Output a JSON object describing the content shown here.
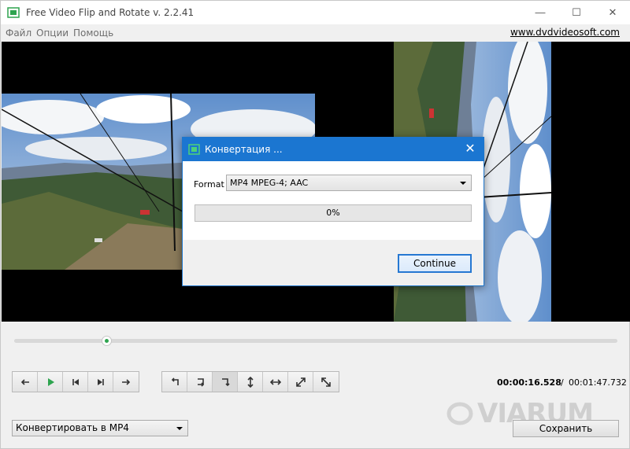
{
  "window": {
    "title": "Free Video Flip and Rotate v. 2.2.41",
    "controls": {
      "minimize": "—",
      "maximize": "☐",
      "close": "✕"
    }
  },
  "menu": {
    "items": [
      "Файл",
      "Опции",
      "Помощь"
    ],
    "site_link": "www.dvdvideosoft.com"
  },
  "player": {
    "seek_position": 0.153,
    "time_current": "00:00:16.528",
    "time_separator": "/",
    "time_total": "00:01:47.732"
  },
  "playback_buttons": [
    "step-back-icon",
    "play-icon",
    "previous-frame-icon",
    "next-frame-icon",
    "step-forward-icon"
  ],
  "rotate_buttons": [
    "rotate-left-icon",
    "rotate-right-icon",
    "rotate-right-down-icon",
    "flip-vertical-icon",
    "flip-horizontal-icon",
    "transpose-icon",
    "transverse-icon"
  ],
  "bottom": {
    "format_option": "Конвертировать в MP4",
    "save_label": "Сохранить"
  },
  "watermark": "VIARUM",
  "dialog": {
    "title": "Конвертация ...",
    "format_label": "Format",
    "format_value": "MP4 MPEG-4; AAC",
    "progress": 0,
    "progress_text": "0%",
    "continue_label": "Continue",
    "close": "✕"
  },
  "colors": {
    "accent": "#1b76d1",
    "play_green": "#2ea44f",
    "video_bg": "#000000"
  }
}
